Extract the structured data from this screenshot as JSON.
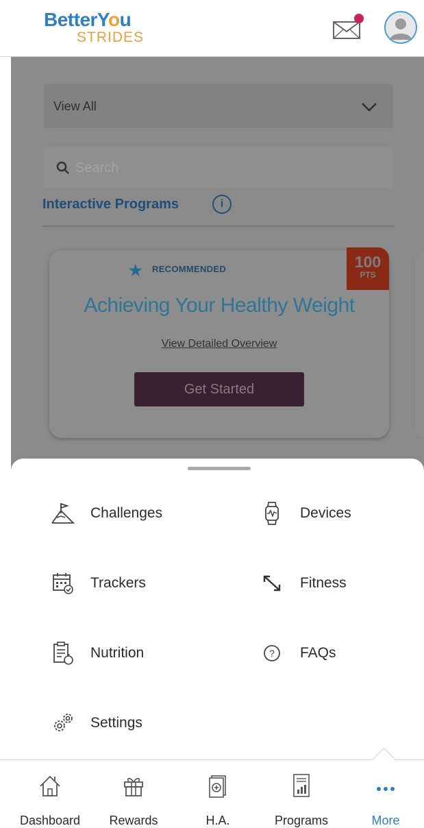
{
  "brand": {
    "line1_a": "BetterY",
    "line1_o": "o",
    "line1_b": "u",
    "line2": "STRIDES"
  },
  "header": {
    "mail_label": "Messages",
    "avatar_label": "Profile"
  },
  "filters": {
    "select_value": "View All",
    "search_placeholder": "Search"
  },
  "section": {
    "title": "Interactive Programs"
  },
  "program_card": {
    "badge": "RECOMMENDED",
    "points": "100",
    "points_unit": "PTS",
    "title": "Achieving Your Healthy Weight",
    "overview_link": "View Detailed Overview",
    "cta": "Get Started"
  },
  "more_menu": [
    {
      "label": "Challenges",
      "icon": "mountain-flag-icon"
    },
    {
      "label": "Devices",
      "icon": "smartwatch-icon"
    },
    {
      "label": "Trackers",
      "icon": "calendar-check-icon"
    },
    {
      "label": "Fitness",
      "icon": "resize-arrows-icon"
    },
    {
      "label": "Nutrition",
      "icon": "clipboard-apple-icon"
    },
    {
      "label": "FAQs",
      "icon": "question-circle-icon"
    },
    {
      "label": "Settings",
      "icon": "gears-icon"
    }
  ],
  "bottom_nav": [
    {
      "label": "Dashboard",
      "icon": "home-icon",
      "active": false
    },
    {
      "label": "Rewards",
      "icon": "gift-icon",
      "active": false
    },
    {
      "label": "H.A.",
      "icon": "health-assessment-icon",
      "active": false
    },
    {
      "label": "Programs",
      "icon": "programs-chart-icon",
      "active": false
    },
    {
      "label": "More",
      "icon": "more-dots-icon",
      "active": true
    }
  ],
  "colors": {
    "brand_blue": "#2f7fc1",
    "brand_orange": "#e8a13b",
    "notification": "#c8245c",
    "cta": "#3b1f33",
    "points_badge": "#8a2a16"
  }
}
